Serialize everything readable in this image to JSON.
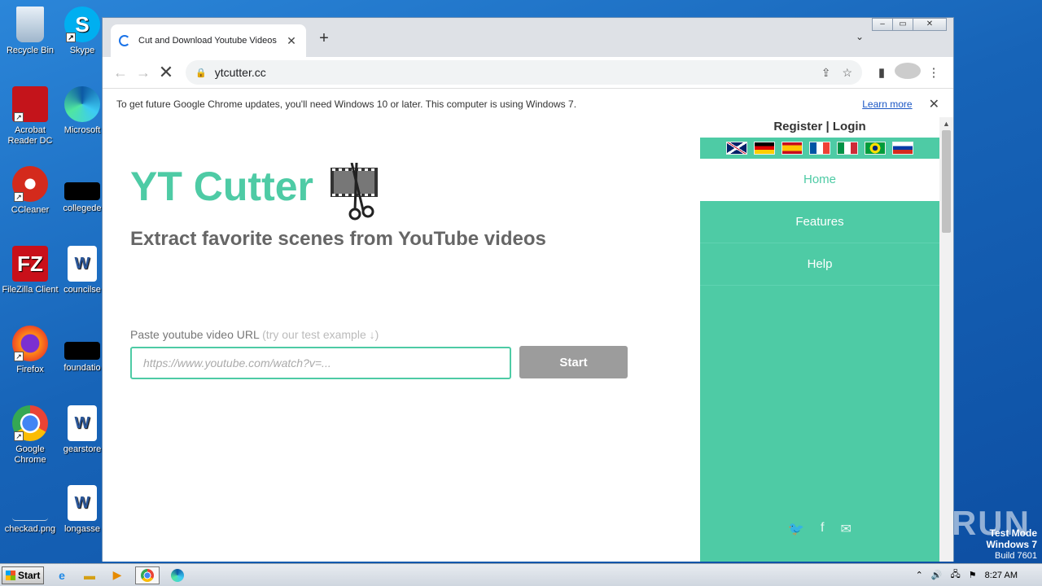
{
  "desktop": {
    "icons": [
      {
        "label": "Recycle Bin",
        "name": "recycle-bin"
      },
      {
        "label": "Skype",
        "name": "skype"
      },
      {
        "label": "Acrobat Reader DC",
        "name": "acrobat-reader"
      },
      {
        "label": "Microsoft",
        "name": "microsoft-edge"
      },
      {
        "label": "CCleaner",
        "name": "ccleaner"
      },
      {
        "label": "collegede",
        "name": "collegede"
      },
      {
        "label": "FileZilla Client",
        "name": "filezilla"
      },
      {
        "label": "councilse",
        "name": "councilse"
      },
      {
        "label": "Firefox",
        "name": "firefox"
      },
      {
        "label": "foundatio",
        "name": "foundatio"
      },
      {
        "label": "Google Chrome",
        "name": "google-chrome"
      },
      {
        "label": "gearstore",
        "name": "gearstore"
      },
      {
        "label": "checkad.png",
        "name": "checkad-png"
      },
      {
        "label": "longasse",
        "name": "longasse"
      }
    ]
  },
  "browser": {
    "tab_title": "Cut and Download Youtube Videos",
    "url": "ytcutter.cc",
    "infobar_message": "To get future Google Chrome updates, you'll need Windows 10 or later. This computer is using Windows 7.",
    "infobar_link": "Learn more"
  },
  "page": {
    "brand": "YT Cutter",
    "tagline": "Extract favorite scenes from YouTube videos",
    "url_label": "Paste youtube video URL",
    "url_hint": "(try our test example ↓)",
    "url_placeholder": "https://www.youtube.com/watch?v=...",
    "start_label": "Start",
    "accent_color": "#4ecba5"
  },
  "sidebar": {
    "auth": "Register | Login",
    "flags": [
      "uk-flag",
      "germany-flag",
      "spain-flag",
      "france-flag",
      "italy-flag",
      "brazil-flag",
      "russia-flag"
    ],
    "nav": {
      "home": "Home",
      "features": "Features",
      "help": "Help"
    }
  },
  "overlay": {
    "watermark": "ANY▷RUN",
    "test_mode": "Test Mode",
    "os": "Windows 7",
    "build": "Build 7601"
  },
  "taskbar": {
    "start": "Start",
    "clock": "8:27 AM"
  }
}
